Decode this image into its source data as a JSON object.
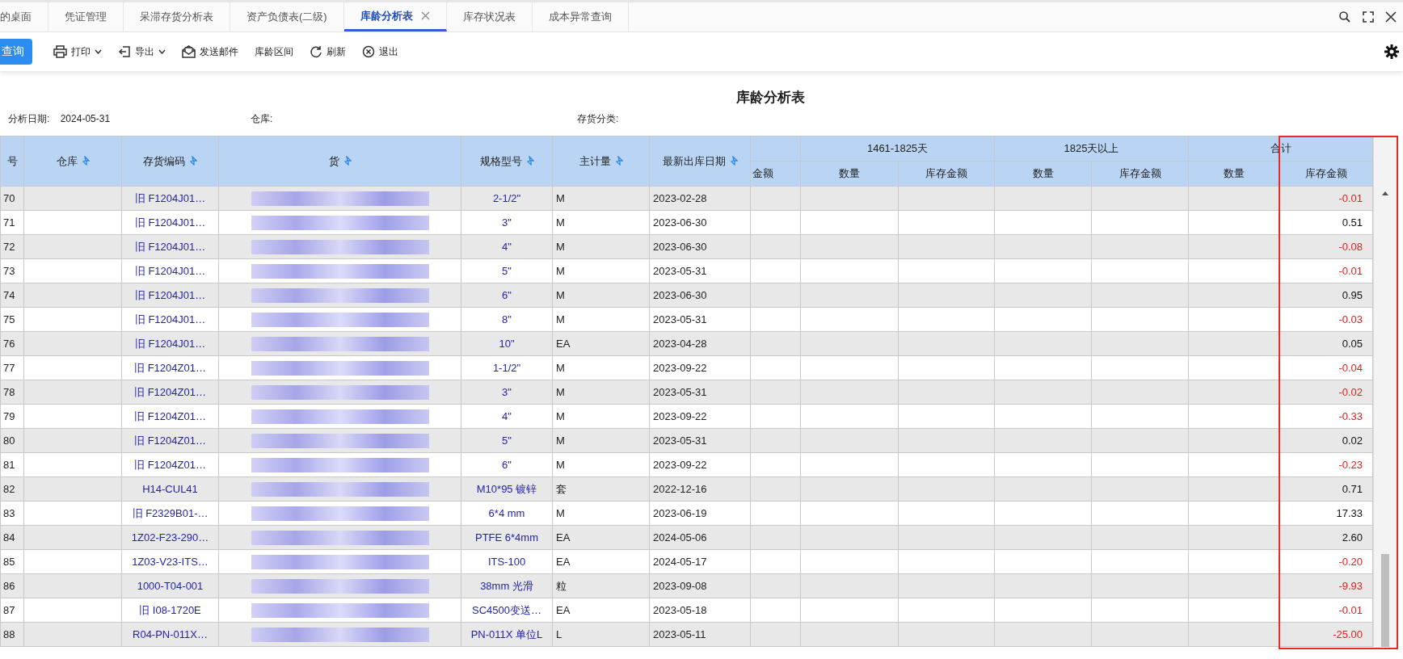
{
  "tabs": [
    {
      "label": "的桌面",
      "selected": false,
      "closable": false
    },
    {
      "label": "凭证管理",
      "selected": false,
      "closable": false
    },
    {
      "label": "呆滞存货分析表",
      "selected": false,
      "closable": false
    },
    {
      "label": "资产负债表(二级)",
      "selected": false,
      "closable": false
    },
    {
      "label": "库龄分析表",
      "selected": true,
      "closable": true
    },
    {
      "label": "库存状况表",
      "selected": false,
      "closable": false
    },
    {
      "label": "成本异常查询",
      "selected": false,
      "closable": false
    }
  ],
  "toolbar": [
    {
      "label": "查询",
      "kind": "primary",
      "dropdown": false
    },
    {
      "label": "打印",
      "kind": "print",
      "dropdown": true
    },
    {
      "label": "导出",
      "kind": "export",
      "dropdown": true
    },
    {
      "label": "发送邮件",
      "kind": "mail",
      "dropdown": false
    },
    {
      "label": "库龄区间",
      "kind": "plain",
      "dropdown": false
    },
    {
      "label": "刷新",
      "kind": "refresh",
      "dropdown": false
    },
    {
      "label": "退出",
      "kind": "exit",
      "dropdown": false
    }
  ],
  "report": {
    "title": "库龄分析表",
    "filters": [
      {
        "label": "分析日期:",
        "value": "2024-05-31"
      },
      {
        "label": "仓库:"
      },
      {
        "label": "存货分类:"
      }
    ]
  },
  "table": {
    "columns": [
      {
        "label": "号",
        "sortable": false
      },
      {
        "label": "仓库",
        "sortable": true
      },
      {
        "label": "存货编码",
        "sortable": true
      },
      {
        "label": "货",
        "sortable": true
      },
      {
        "label": "规格型号",
        "sortable": true
      },
      {
        "label": "主计量",
        "sortable": true
      },
      {
        "label": "最新出库日期",
        "sortable": true
      }
    ],
    "groups": [
      {
        "columns": [
          "金额"
        ]
      },
      {
        "label": "1461-1825天",
        "columns": [
          "数量",
          "库存金额"
        ]
      },
      {
        "label": "1825天以上",
        "columns": [
          "数量",
          "库存金额"
        ]
      },
      {
        "label": "合计",
        "columns": [
          "数量",
          "库存金额"
        ]
      }
    ],
    "rows": [
      {
        "no": "70",
        "code": "旧 F1204J01…",
        "spec": "2-1/2\"",
        "unit": "M",
        "date": "2023-02-28",
        "total_amount": "-0.01",
        "negative": true
      },
      {
        "no": "71",
        "code": "旧 F1204J01…",
        "spec": "3\"",
        "unit": "M",
        "date": "2023-06-30",
        "total_amount": "0.51",
        "negative": false
      },
      {
        "no": "72",
        "code": "旧 F1204J01…",
        "spec": "4\"",
        "unit": "M",
        "date": "2023-06-30",
        "total_amount": "-0.08",
        "negative": true
      },
      {
        "no": "73",
        "code": "旧 F1204J01…",
        "spec": "5\"",
        "unit": "M",
        "date": "2023-05-31",
        "total_amount": "-0.01",
        "negative": true
      },
      {
        "no": "74",
        "code": "旧 F1204J01…",
        "spec": "6\"",
        "unit": "M",
        "date": "2023-06-30",
        "total_amount": "0.95",
        "negative": false
      },
      {
        "no": "75",
        "code": "旧 F1204J01…",
        "spec": "8\"",
        "unit": "M",
        "date": "2023-05-31",
        "total_amount": "-0.03",
        "negative": true
      },
      {
        "no": "76",
        "code": "旧 F1204J01…",
        "spec": "10\"",
        "unit": "EA",
        "date": "2023-04-28",
        "total_amount": "0.05",
        "negative": false
      },
      {
        "no": "77",
        "code": "旧 F1204Z01…",
        "spec": "1-1/2\"",
        "unit": "M",
        "date": "2023-09-22",
        "total_amount": "-0.04",
        "negative": true
      },
      {
        "no": "78",
        "code": "旧 F1204Z01…",
        "spec": "3\"",
        "unit": "M",
        "date": "2023-05-31",
        "total_amount": "-0.02",
        "negative": true
      },
      {
        "no": "79",
        "code": "旧 F1204Z01…",
        "spec": "4\"",
        "unit": "M",
        "date": "2023-09-22",
        "total_amount": "-0.33",
        "negative": true
      },
      {
        "no": "80",
        "code": "旧 F1204Z01…",
        "spec": "5\"",
        "unit": "M",
        "date": "2023-05-31",
        "total_amount": "0.02",
        "negative": false
      },
      {
        "no": "81",
        "code": "旧 F1204Z01…",
        "spec": "6\"",
        "unit": "M",
        "date": "2023-09-22",
        "total_amount": "-0.23",
        "negative": true
      },
      {
        "no": "82",
        "code": "H14-CUL41",
        "spec": "M10*95 镀锌",
        "unit": "套",
        "date": "2022-12-16",
        "total_amount": "0.71",
        "negative": false
      },
      {
        "no": "83",
        "code": "旧 F2329B01-…",
        "spec": "6*4 mm",
        "unit": "M",
        "date": "2023-06-19",
        "total_amount": "17.33",
        "negative": false
      },
      {
        "no": "84",
        "code": "1Z02-F23-290…",
        "spec": "PTFE 6*4mm",
        "unit": "EA",
        "date": "2024-05-06",
        "total_amount": "2.60",
        "negative": false
      },
      {
        "no": "85",
        "code": "1Z03-V23-ITS…",
        "spec": "ITS-100",
        "unit": "EA",
        "date": "2024-05-17",
        "total_amount": "-0.20",
        "negative": true
      },
      {
        "no": "86",
        "code": "1000-T04-001",
        "spec": "38mm 光滑",
        "unit": "粒",
        "date": "2023-09-08",
        "total_amount": "-9.93",
        "negative": true
      },
      {
        "no": "87",
        "code": "旧 I08-1720E",
        "spec": "SC4500变送…",
        "unit": "EA",
        "date": "2023-05-18",
        "total_amount": "-0.01",
        "negative": true
      },
      {
        "no": "88",
        "code": "R04-PN-011X…",
        "spec": "PN-011X 单位L",
        "unit": "L",
        "date": "2023-05-11",
        "total_amount": "-25.00",
        "negative": true
      }
    ]
  }
}
